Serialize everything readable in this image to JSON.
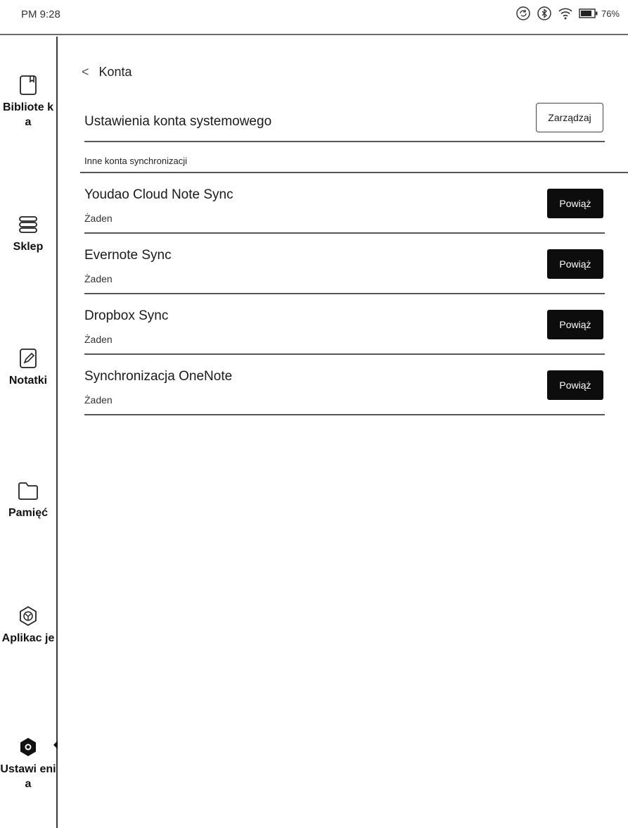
{
  "status_bar": {
    "time": "PM 9:28",
    "battery": "76%",
    "icons": [
      "sync-icon",
      "bluetooth-icon",
      "wifi-icon",
      "battery-icon"
    ]
  },
  "sidebar": {
    "items": [
      {
        "label": "Bibliote ka",
        "icon": "book-icon"
      },
      {
        "label": "Sklep",
        "icon": "store-icon"
      },
      {
        "label": "Notatki",
        "icon": "note-icon"
      },
      {
        "label": "Pamięć",
        "icon": "folder-icon"
      },
      {
        "label": "Aplikac je",
        "icon": "apps-icon"
      },
      {
        "label": "Ustawi enia",
        "icon": "settings-icon",
        "active": true
      }
    ]
  },
  "header": {
    "back_label": "Konta"
  },
  "system_account": {
    "title": "Ustawienia konta systemowego",
    "manage_label": "Zarządzaj"
  },
  "section": {
    "title": "Inne konta synchronizacji"
  },
  "accounts": [
    {
      "name": "Youdao Cloud Note Sync",
      "status": "Żaden",
      "button": "Powiąż"
    },
    {
      "name": "Evernote Sync",
      "status": "Żaden",
      "button": "Powiąż"
    },
    {
      "name": "Dropbox Sync",
      "status": "Żaden",
      "button": "Powiąż"
    },
    {
      "name": "Synchronizacja OneNote",
      "status": "Żaden",
      "button": "Powiąż"
    }
  ]
}
